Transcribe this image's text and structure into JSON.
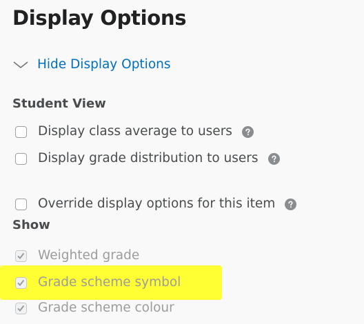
{
  "heading": "Display Options",
  "toggle": {
    "label": "Hide Display Options",
    "icon": "chevron-down-icon"
  },
  "student_view": {
    "heading": "Student View",
    "options": [
      {
        "label": "Display class average to users",
        "checked": false,
        "help": true
      },
      {
        "label": "Display grade distribution to users",
        "checked": false,
        "help": true
      }
    ]
  },
  "override": {
    "label": "Override display options for this item",
    "checked": false,
    "help": true
  },
  "show": {
    "heading": "Show",
    "options": [
      {
        "label": "Weighted grade",
        "checked": true,
        "disabled": true
      },
      {
        "label": "Grade scheme symbol",
        "checked": true,
        "disabled": true,
        "highlighted": true
      },
      {
        "label": "Grade scheme colour",
        "checked": true,
        "disabled": true
      }
    ]
  },
  "colors": {
    "link": "#006fbf",
    "text": "#494c4e",
    "disabled_text": "#9a9c9e",
    "highlight": "#ffff33",
    "background": "#f9f9f9"
  }
}
